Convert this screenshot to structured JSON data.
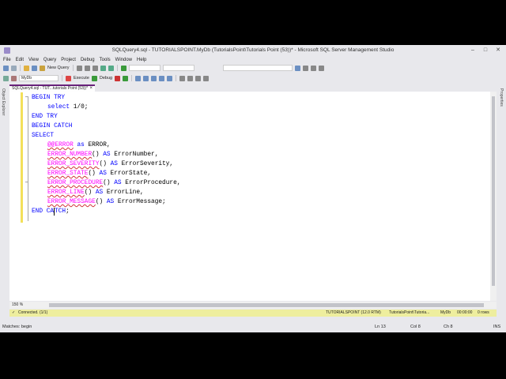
{
  "window": {
    "title": "SQLQuery4.sql - TUTORIALSPOINT.MyDb (TutorialsPoint\\Tutorials Point (53))* - Microsoft SQL Server Management Studio"
  },
  "menu": [
    "File",
    "Edit",
    "View",
    "Query",
    "Project",
    "Debug",
    "Tools",
    "Window",
    "Help"
  ],
  "toolbar": {
    "new_query": "New Query",
    "database": "MyDb",
    "execute": "Execute",
    "debug": "Debug"
  },
  "side_panels": {
    "left": "Object Explorer",
    "right": "Properties"
  },
  "document_tab": {
    "label": "SQLQuery4.sql - TUT...tutorials Point (53))*",
    "close": "×"
  },
  "code_lines": [
    {
      "indent": 0,
      "tokens": [
        {
          "t": "BEGIN TRY",
          "c": "kw"
        }
      ]
    },
    {
      "indent": 1,
      "tokens": [
        {
          "t": "select",
          "c": "kw"
        },
        {
          "t": " 1/0;",
          "c": "tx"
        }
      ]
    },
    {
      "indent": 0,
      "tokens": [
        {
          "t": "END TRY",
          "c": "kw"
        }
      ]
    },
    {
      "indent": 0,
      "tokens": [
        {
          "t": "BEGIN CATCH",
          "c": "kw"
        }
      ]
    },
    {
      "indent": 0,
      "tokens": [
        {
          "t": "SELECT",
          "c": "kw"
        }
      ]
    },
    {
      "indent": 1,
      "tokens": [
        {
          "t": "@@ERROR",
          "c": "sys",
          "u": true
        },
        {
          "t": " as ",
          "c": "kw"
        },
        {
          "t": "ERROR,",
          "c": "tx"
        }
      ]
    },
    {
      "indent": 1,
      "tokens": [
        {
          "t": "ERROR_NUMBER",
          "c": "fn",
          "u": true
        },
        {
          "t": "() ",
          "c": "tx"
        },
        {
          "t": "AS",
          "c": "kw"
        },
        {
          "t": " ErrorNumber,",
          "c": "tx"
        }
      ]
    },
    {
      "indent": 1,
      "tokens": [
        {
          "t": "ERROR_SEVERITY",
          "c": "fn",
          "u": true
        },
        {
          "t": "() ",
          "c": "tx"
        },
        {
          "t": "AS",
          "c": "kw"
        },
        {
          "t": " ErrorSeverity,",
          "c": "tx"
        }
      ]
    },
    {
      "indent": 1,
      "tokens": [
        {
          "t": "ERROR_STATE",
          "c": "fn",
          "u": true
        },
        {
          "t": "() ",
          "c": "tx"
        },
        {
          "t": "AS",
          "c": "kw"
        },
        {
          "t": " ErrorState,",
          "c": "tx"
        }
      ]
    },
    {
      "indent": 1,
      "tokens": [
        {
          "t": "ERROR_PROCEDURE",
          "c": "fn",
          "u": true
        },
        {
          "t": "() ",
          "c": "tx"
        },
        {
          "t": "AS",
          "c": "kw"
        },
        {
          "t": " ErrorProcedure,",
          "c": "tx"
        }
      ]
    },
    {
      "indent": 1,
      "tokens": [
        {
          "t": "ERROR_LINE",
          "c": "fn",
          "u": true
        },
        {
          "t": "() ",
          "c": "tx"
        },
        {
          "t": "AS",
          "c": "kw"
        },
        {
          "t": " ErrorLine,",
          "c": "tx"
        }
      ]
    },
    {
      "indent": 1,
      "tokens": [
        {
          "t": "ERROR_MESSAGE",
          "c": "fn",
          "u": true
        },
        {
          "t": "() ",
          "c": "tx"
        },
        {
          "t": "AS",
          "c": "kw"
        },
        {
          "t": " ErrorMessage;",
          "c": "tx"
        }
      ]
    },
    {
      "indent": 0,
      "tokens": [
        {
          "t": "END CA",
          "c": "kw"
        },
        {
          "caret": true
        },
        {
          "t": "TCH",
          "c": "kw"
        },
        {
          "t": ";",
          "c": "tx"
        }
      ]
    }
  ],
  "zoom": "150 %",
  "query_status": {
    "connected": "Connected. (1/1)",
    "server": "TUTORIALSPOINT (12.0 RTM)",
    "login": "TutorialsPoint\\Tutoria...",
    "database": "MyDb",
    "elapsed": "00:00:00",
    "rows": "0 rows"
  },
  "statusbar": {
    "message": "Matches: begin",
    "ln": "Ln 13",
    "col": "Col 8",
    "ch": "Ch 8",
    "mode": "INS"
  },
  "colors": {
    "keyword": "#0000ff",
    "function": "#ff00ff",
    "accent": "#68217a",
    "status_yellow": "#eeee9e"
  }
}
